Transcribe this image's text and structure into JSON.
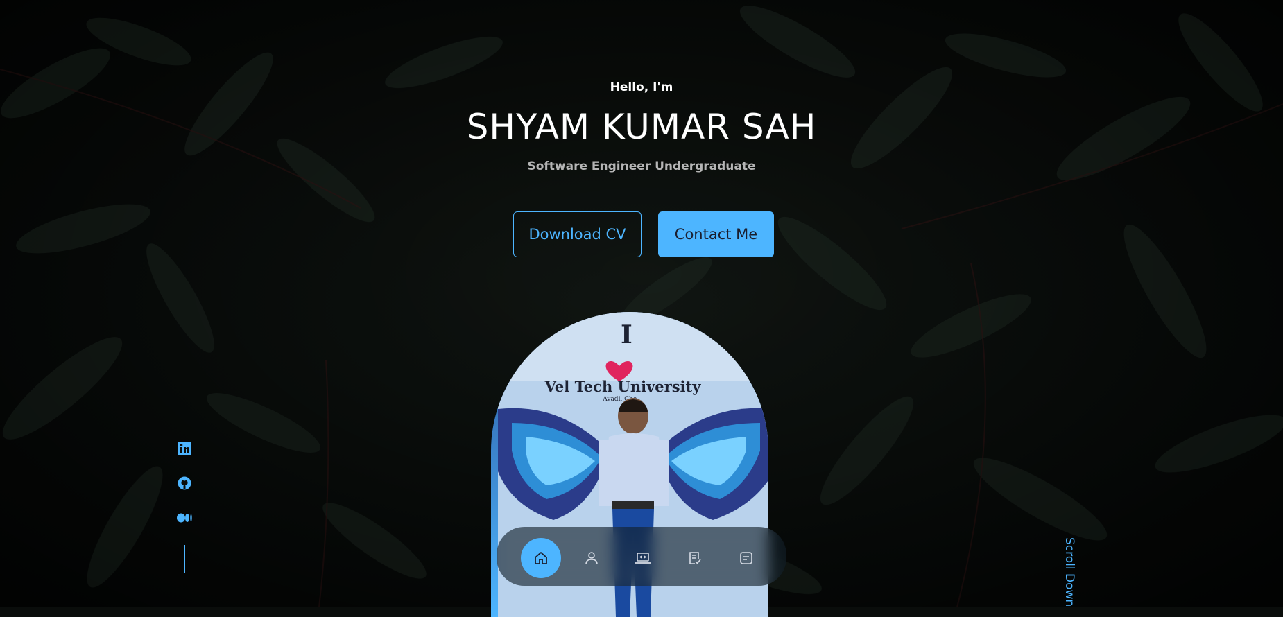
{
  "hero": {
    "greeting": "Hello, I'm",
    "name": "SHYAM KUMAR SAH",
    "tagline": "Software Engineer Undergraduate"
  },
  "buttons": {
    "download_cv": "Download CV",
    "contact_me": "Contact Me"
  },
  "photo": {
    "sign_text_top": "I",
    "sign_text": "Vel Tech University",
    "sign_subtext": "Avadi, Che..."
  },
  "social": {
    "icons": [
      "linkedin-icon",
      "github-icon",
      "medium-icon"
    ]
  },
  "scroll_label": "Scroll Down",
  "nav": {
    "active": "home",
    "items": [
      "home-icon",
      "user-icon",
      "laptop-icon",
      "checklist-icon",
      "message-icon"
    ]
  },
  "colors": {
    "accent": "#4db5ff",
    "text": "#ffffff",
    "muted": "#b5b5b5",
    "dark_text": "#1b1e2e"
  }
}
